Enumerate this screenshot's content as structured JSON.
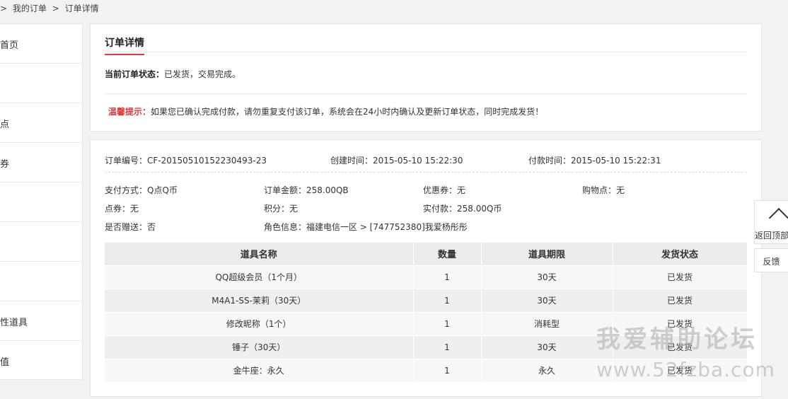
{
  "breadcrumb": {
    "sep1": ">",
    "item1": "我的订单",
    "sep2": ">",
    "item2": "订单详情"
  },
  "sidebar": {
    "items": [
      {
        "label": "首页"
      },
      {
        "label": ""
      },
      {
        "label": "点"
      },
      {
        "label": "券"
      },
      {
        "label": ""
      },
      {
        "label": ""
      },
      {
        "label": ""
      },
      {
        "label": "性道具"
      },
      {
        "label": "值"
      }
    ]
  },
  "order_panel": {
    "tab": "订单详情",
    "status_label": "当前订单状态：",
    "status_value": "已发货，交易完成。",
    "tip_label": "温馨提示：",
    "tip_text": "如果您已确认完成付款，请勿重复支付该订单，系统会在24小时内确认及更新订单状态，同时完成发货！"
  },
  "order_meta": {
    "order_no": "订单编号：CF-20150510152230493-23",
    "created": "创建时间：2015-05-10 15:22:30",
    "paid": "付款时间：2015-05-10 15:22:31"
  },
  "order_info": {
    "pay_method": "支付方式：Q点Q币",
    "amount": "订单金额：258.00QB",
    "coupon": "优惠券：无",
    "shop_points": "购物点：无",
    "point_coupon": "点券：无",
    "score": "积分：无",
    "actual_paid": "实付款：258.00Q币",
    "is_gift": "是否赠送：否",
    "role_info": "角色信息：福建电信一区 > [747752380]我爱杨彤彤"
  },
  "items_table": {
    "headers": [
      "道具名称",
      "数量",
      "道具期限",
      "发货状态"
    ],
    "rows": [
      [
        "QQ超级会员（1个月）",
        "1",
        "30天",
        "已发货"
      ],
      [
        "M4A1-SS-茉莉（30天）",
        "1",
        "30天",
        "已发货"
      ],
      [
        "修改昵称（1个）",
        "1",
        "消耗型",
        "已发货"
      ],
      [
        "锤子（30天）",
        "1",
        "30天",
        "已发货"
      ],
      [
        "金牛座：永久",
        "1",
        "永久",
        "已发货"
      ]
    ]
  },
  "float_buttons": {
    "back_top": "返回顶部",
    "feedback": "反馈"
  },
  "watermark": {
    "cn": "我爱辅助论坛",
    "url": "www.52fzba.com"
  }
}
